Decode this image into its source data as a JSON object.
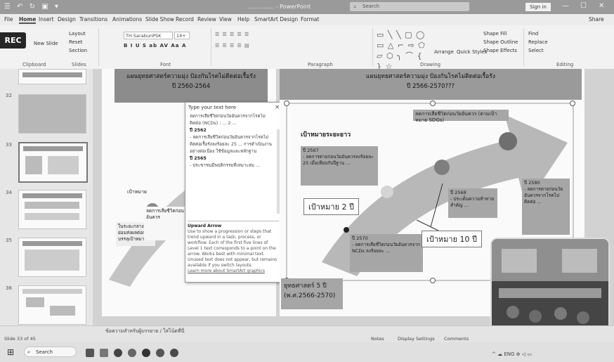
{
  "window": {
    "qat_icons": "☰ ↶ ↻ ▣ ▾",
    "doc_title": "............... - PowerPoint",
    "search_placeholder": "Search",
    "signin": "Sign in",
    "controls": [
      "—",
      "☐",
      "✕"
    ]
  },
  "menu": {
    "tabs": [
      "File",
      "Home",
      "Insert",
      "Design",
      "Transitions",
      "Animations",
      "Slide Show",
      "Record",
      "Review",
      "View",
      "Help",
      "SmartArt Design",
      "Format"
    ],
    "active": "Home",
    "share": "Share"
  },
  "ribbon": {
    "rec": "REC",
    "groups": [
      "Clipboard",
      "Slides",
      "Font",
      "Paragraph",
      "Drawing",
      "Editing"
    ],
    "new_slide": "New Slide",
    "layout": "Layout",
    "reset": "Reset",
    "section": "Section",
    "font_name": "TH SarabunPSK",
    "font_size": "14+",
    "font_format_row": "B I U S ab AV Aa A",
    "para_row1": "☰ ☰ ☰ ☰ ☰",
    "para_row2": "☰ ☰ ☰ ☰ ▤",
    "arrange": "Arrange",
    "quick_styles": "Quick Styles",
    "shape_fill": "Shape Fill",
    "shape_outline": "Shape Outline",
    "shape_effects": "Shape Effects",
    "find": "Find",
    "replace": "Replace",
    "select": "Select",
    "shapes_glyphs": "▭ ╲ ╲ ▢ ◯ ▭ △ ⌐ ⇨ ⬠ ▱ ⬡ ╮ ⌒ { } ☆"
  },
  "thumbnails": [
    {
      "num": "",
      "selected": false
    },
    {
      "num": "32",
      "selected": false
    },
    {
      "num": "33",
      "selected": true
    },
    {
      "num": "34",
      "selected": false
    },
    {
      "num": "35",
      "selected": false
    },
    {
      "num": "36",
      "selected": false
    }
  ],
  "left_slide": {
    "header_line1": "แผนยุทธศาสตร์ความมุ่ง ป้องกันโรคไม่ติดต่อเรื้อรัง",
    "header_line2": "ปี 2560-2564",
    "goal_label": "เป้าหมาย",
    "callout_a": "ในระยะกลาง ย่อมส่งผลต่อการบรรลุเป้าหมาย",
    "callout_b": "ลดการเสียชีวิตก่อนวัยอันควร"
  },
  "text_pane": {
    "title": "Type your text here",
    "close": "✕",
    "intro": "ลดการเสียชีวิตก่อนวัยอันควรจากโรคไม่ติดต่อ (NCDs) : ... 2 ...",
    "bullet1": "ปี 2562",
    "bullet1_text": "- ลดการเสียชีวิตก่อนวัยอันควรจากโรคไม่ติดต่อเรื้อรังลงร้อยละ 25 ... การดำเนินงานอย่างต่อเนื่อง ใช้ข้อมูลและหลักฐาน",
    "bullet2": "ปี 2565",
    "bullet2_text": "- ประชาชนมีพฤติกรรมที่เหมาะสม ...",
    "help_title": "Upward Arrow",
    "help_text": "Use to show a progression or steps that trend upward in a task, process, or workflow. Each of the first five lines of Level 1 text corresponds to a point on the arrow. Works best with minimal text. Unused text does not appear, but remains available if you switch layouts.",
    "help_link": "Learn more about SmartArt graphics"
  },
  "right_slide": {
    "header_line1": "แผนยุทธศาสตร์ความมุ่ง ป้องกันโรคไม่ติดต่อเรื้อรัง",
    "header_line2": "ปี 2566-2570???",
    "vision_label": "เป้าหมายระยะยาว",
    "top_callout": "ลดการเสียชีวิตก่อนวัยอันควร (ตามเป้าหมาย SDGs)",
    "callout_2567": "ปี 2567",
    "callout_2567_text": "- ลดการตายก่อนวัยอันควรลงร้อยละ 25 เมื่อเทียบกับปีฐาน ...",
    "goal_2": "เป้าหมาย 2 ปี",
    "callout_2568": "ปี 2568",
    "callout_2568_text": "- ประเด็นความท้าทายสำคัญ ...",
    "callout_2570": "ปี 2570",
    "callout_2570_text": "- ลดการเสียชีวิตก่อนวัยอันควรจาก NCDs ลงร้อยละ ...",
    "goal_10": "เป้าหมาย 10 ปี",
    "callout_2580": "ปี 2580",
    "callout_2580_text": "- ลดการตายก่อนวัยอันควรจากโรคไม่ติดต่อ ...",
    "plan_line1": "ยุทธศาสตร์ 5 ปี",
    "plan_line2": "(พ.ศ.2566-2570)"
  },
  "status": {
    "slide": "Slide 33 of 45",
    "notes_text": "ข้อความสำหรับผู้บรรยาย / ใส่โน้ตที่นี่",
    "notes_btn": "Notes",
    "display": "Display Settings",
    "comments": "Comments"
  },
  "taskbar": {
    "search": "Search",
    "tray": "^ ☁ ENG ⊕ ◁ ▭"
  }
}
